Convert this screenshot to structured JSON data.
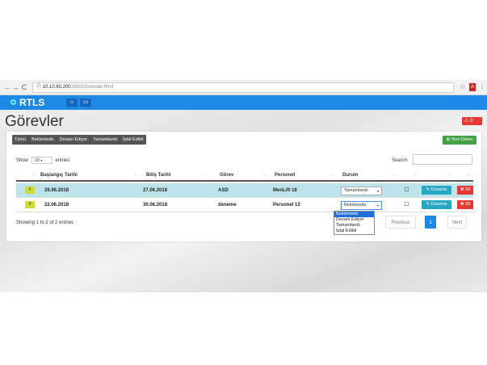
{
  "browser": {
    "url_host": "10.10.60.200",
    "url_path": ":8003/Gorevler.html",
    "back_glyph": "←",
    "forward_glyph": "→",
    "reload_glyph": "C",
    "info_glyph": "ⓘ",
    "star_glyph": "☆",
    "menu_glyph": "⋮"
  },
  "appbar": {
    "brand": "RTLS",
    "home_glyph": "⌂",
    "map_glyph": "▭"
  },
  "page": {
    "title": "Görevler",
    "alert_glyph": "⚠",
    "alert_count": "0"
  },
  "filters": [
    "Tümü",
    "Beklemede",
    "Devam Ediyor",
    "Tamamlandı",
    "İptal Edildi"
  ],
  "new_task_label": "Yeni Görev",
  "new_task_glyph": "⊞",
  "length": {
    "show": "Show",
    "value": "10",
    "caret": "▾",
    "entries": "entries"
  },
  "search_label": "Search:",
  "table": {
    "headers": {
      "id_sort": "↑",
      "start": "Başlangıç Tarihi",
      "end": "Bitiş Tarihi",
      "task": "Görev",
      "staff": "Personel",
      "status": "Durum"
    },
    "sort_glyph": "↑↓",
    "rows": [
      {
        "id": "0",
        "start": "26.06.2018",
        "end": "27.06.2018",
        "task": "ASD",
        "staff": "MenLift 18",
        "status": "Tamamlandı"
      },
      {
        "id": "0",
        "start": "22.06.2018",
        "end": "30.06.2018",
        "task": "deneme",
        "staff": "Personel 12",
        "status": "Beklemede"
      }
    ],
    "edit_label": "Düzenle",
    "edit_glyph": "✎",
    "delete_label": "Sil",
    "delete_glyph": "✖",
    "comment_glyph": "☐",
    "caret": "▾"
  },
  "status_options": [
    "Beklemede",
    "Devam Ediyor",
    "Tamamlandı",
    "İptal Edildi"
  ],
  "info": "Showing 1 to 2 of 2 entries",
  "pagination": {
    "previous": "Previous",
    "page": "1",
    "next": "Next"
  }
}
